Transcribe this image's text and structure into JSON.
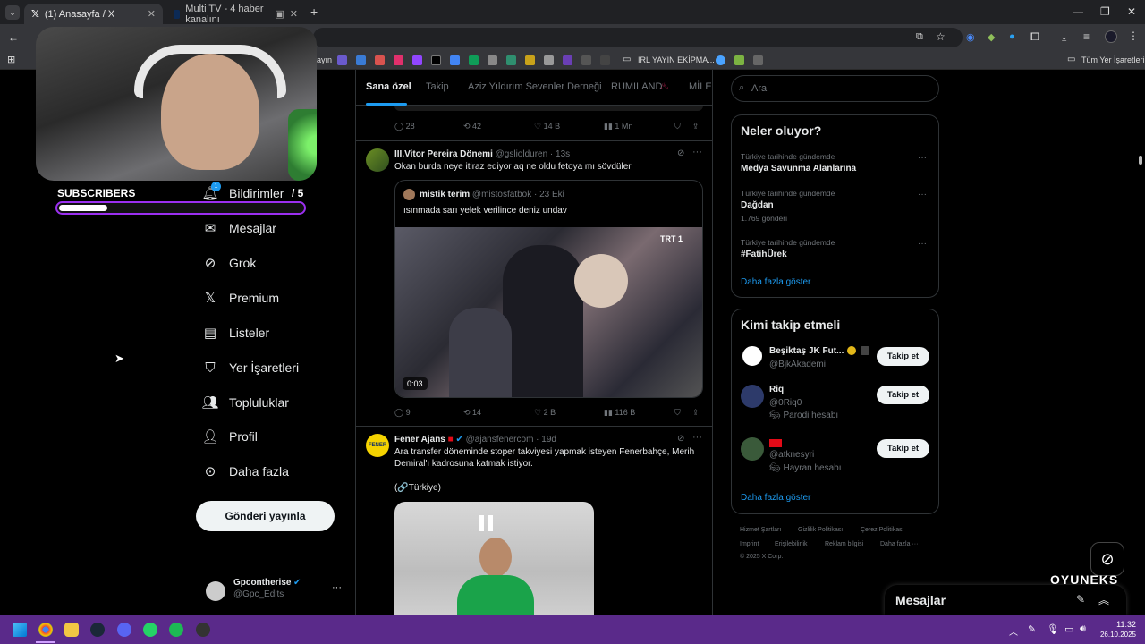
{
  "browser": {
    "tabs": [
      {
        "title": "(1) Anasayfa / X",
        "active": true
      },
      {
        "title": "Multi TV - 4 haber kanalını",
        "active": false
      }
    ],
    "new_tab": "+",
    "bookmark_partial": "ayın",
    "bookmark_folder": "IRL YAYIN EKİPMA...",
    "all_bookmarks": "Tüm Yer İşaretleri"
  },
  "overlay": {
    "subscribers_label": "SUBSCRIBERS",
    "subscribers_count": "/ 5",
    "subscribers_progress": 0.2
  },
  "nav": {
    "notification_badge": "1",
    "items": [
      {
        "label": "Bildirimler",
        "icon": "bell-icon"
      },
      {
        "label": "Mesajlar",
        "icon": "envelope-icon"
      },
      {
        "label": "Grok",
        "icon": "grok-icon"
      },
      {
        "label": "Premium",
        "icon": "x-logo-icon"
      },
      {
        "label": "Listeler",
        "icon": "list-icon"
      },
      {
        "label": "Yer İşaretleri",
        "icon": "bookmark-icon"
      },
      {
        "label": "Topluluklar",
        "icon": "people-icon"
      },
      {
        "label": "Profil",
        "icon": "person-icon"
      },
      {
        "label": "Daha fazla",
        "icon": "more-circle-icon"
      }
    ],
    "post_button": "Gönderi yayınla",
    "account": {
      "name": "Gpcontherise",
      "handle": "@Gpc_Edits",
      "more": "···"
    }
  },
  "feed": {
    "tabs": [
      "Sana özel",
      "Takip",
      "Aziz Yıldırım Sevenler Derneği",
      "RUMILAND",
      "MİLEN"
    ],
    "top_actions": {
      "replies": "28",
      "reposts": "42",
      "likes": "14 B",
      "views": "1 Mn"
    },
    "tweets": [
      {
        "author": "III.Vitor Pereira Dönemi",
        "handle": "@gsliolduren · 13s",
        "text": "Okan burda neye itiraz ediyor aq ne oldu fetoya mı sövdüler",
        "quote": {
          "author": "mistik terim",
          "handle": "@mistosfatbok · 23 Eki",
          "text": "ısınmada sarı yelek verilince deniz undav",
          "video_duration": "0:03",
          "channel_logo": "TRT 1"
        },
        "actions": {
          "replies": "9",
          "reposts": "14",
          "likes": "2 B",
          "views": "116 B"
        }
      },
      {
        "author": "Fener Ajans",
        "handle": "@ajansfenercom · 19d",
        "text": "Ara transfer döneminde stoper takviyesi yapmak isteyen Fenerbahçe, Merih Demiral'ı kadrosuna katmak istiyor.",
        "source": "(🔗Türkiye)"
      }
    ]
  },
  "sidebar": {
    "search_placeholder": "Ara",
    "trends": {
      "title": "Neler oluyor?",
      "items": [
        {
          "context": "Türkiye tarihinde gündemde",
          "topic": "Medya Savunma Alanlarına",
          "count": ""
        },
        {
          "context": "Türkiye tarihinde gündemde",
          "topic": "Dağdan",
          "count": "1.769 gönderi"
        },
        {
          "context": "Türkiye tarihinde gündemde",
          "topic": "#FatihÜrek",
          "count": ""
        }
      ],
      "more": "Daha fazla göster"
    },
    "who_to_follow": {
      "title": "Kimi takip etmeli",
      "users": [
        {
          "name": "Beşiktaş JK Fut...",
          "handle": "@BjkAkademi",
          "note": ""
        },
        {
          "name": "Riq",
          "handle": "@0Riq0",
          "note": "Parodi hesabı"
        },
        {
          "name": "",
          "handle": "@atknesyri",
          "note": "Hayran hesabı"
        }
      ],
      "follow_label": "Takip et",
      "more": "Daha fazla göster"
    },
    "footer": {
      "links": [
        "Hizmet Şartları",
        "Gizlilik Politikası",
        "Çerez Politikası",
        "Imprint",
        "Erişilebilirlik",
        "Reklam bilgisi",
        "Daha fazla ···"
      ],
      "copyright": "© 2025 X Corp."
    }
  },
  "messages_dock": {
    "title": "Mesajlar"
  },
  "watermark": "OYUNEKS",
  "taskbar": {
    "time": "11:32",
    "date": "26.10.2025"
  },
  "colors": {
    "accent": "#1d9bf0",
    "taskbar": "#5a2a8a",
    "border": "#2f3336"
  }
}
